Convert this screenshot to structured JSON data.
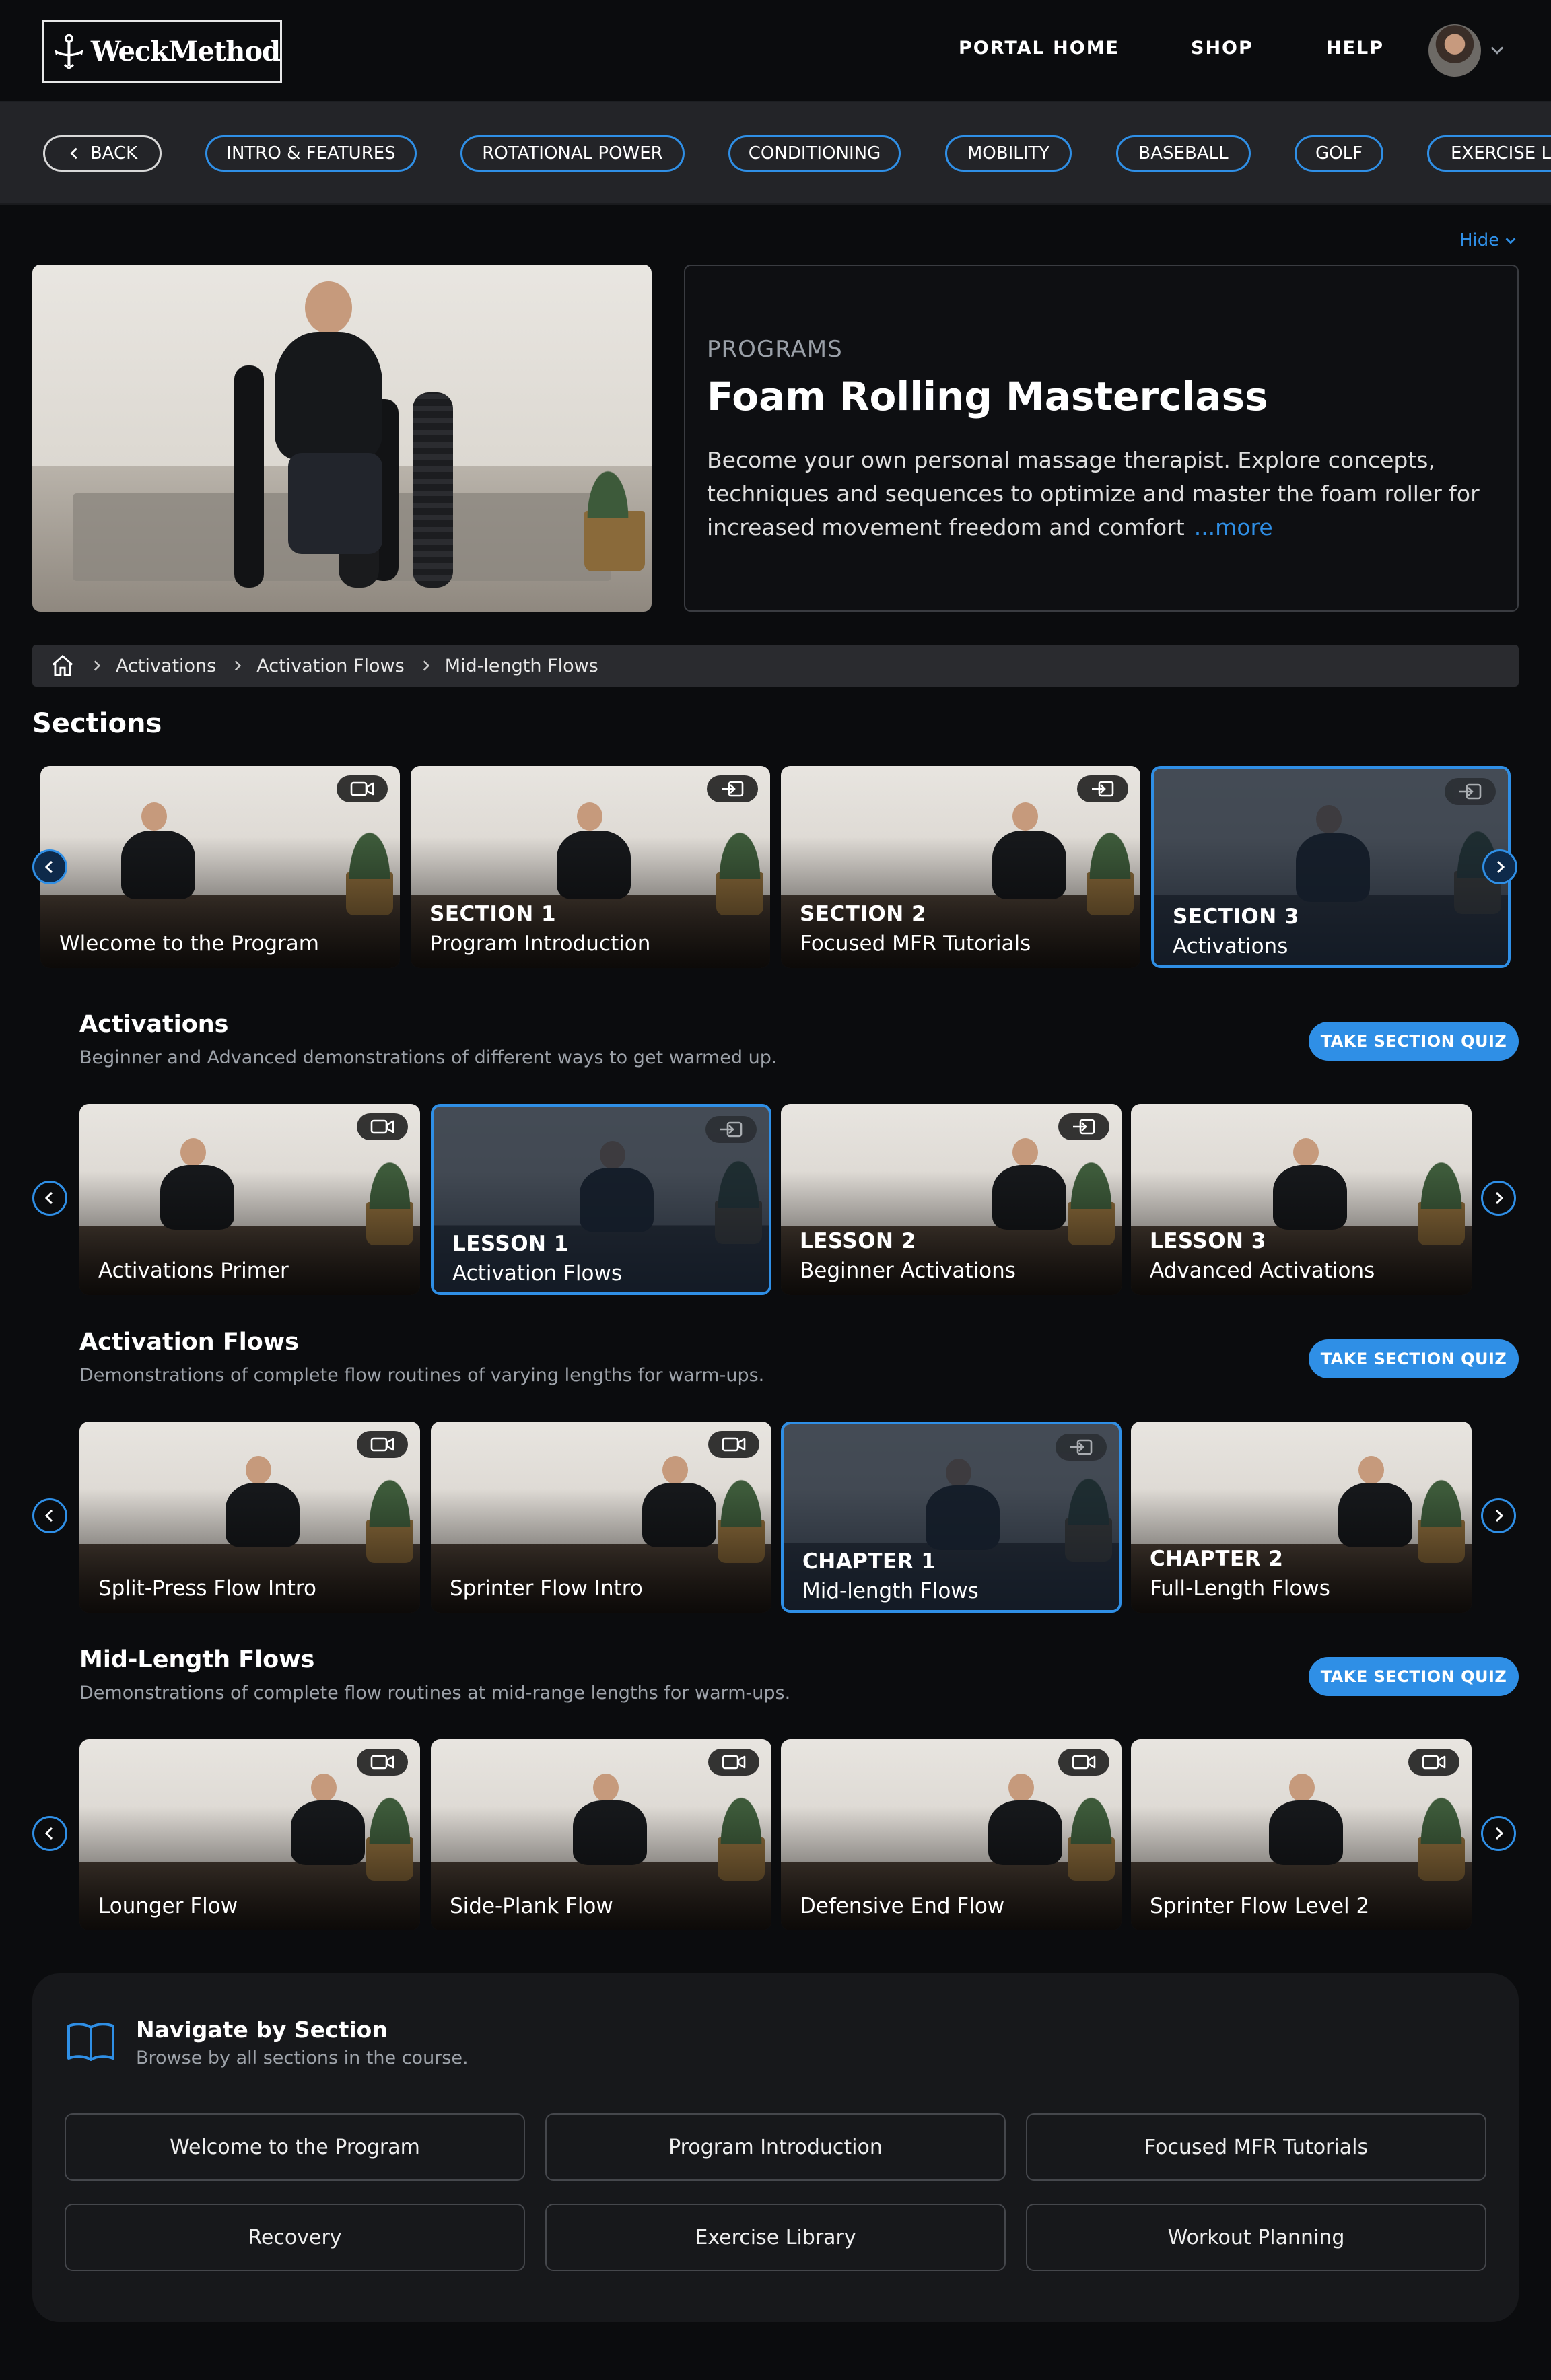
{
  "header": {
    "logo_text": "WeckMethod",
    "nav": [
      "PORTAL HOME",
      "SHOP",
      "HELP"
    ]
  },
  "filters": {
    "back": "BACK",
    "pills": [
      "INTRO & FEATURES",
      "ROTATIONAL POWER",
      "CONDITIONING",
      "MOBILITY",
      "BASEBALL",
      "GOLF",
      "EXERCISE LI"
    ]
  },
  "hero": {
    "hide": "Hide",
    "eyebrow": "PROGRAMS",
    "title": "Foam Rolling Masterclass",
    "description": "Become your own personal massage therapist. Explore concepts, techniques and sequences to optimize and master the foam roller for increased movement freedom and comfort",
    "more": "...more"
  },
  "breadcrumb": [
    "Activations",
    "Activation Flows",
    "Mid-length Flows"
  ],
  "sections_heading": "Sections",
  "sections": [
    {
      "top": "",
      "label": "Wlecome to the Program",
      "icon": "video-icon",
      "active": false
    },
    {
      "top": "SECTION 1",
      "label": "Program Introduction",
      "icon": "enter-icon",
      "active": false
    },
    {
      "top": "SECTION 2",
      "label": "Focused MFR Tutorials",
      "icon": "enter-icon",
      "active": false
    },
    {
      "top": "SECTION 3",
      "label": "Activations",
      "icon": "enter-icon",
      "active": true
    }
  ],
  "groups": [
    {
      "title": "Activations",
      "description": "Beginner and Advanced demonstrations of different ways to get warmed up.",
      "quiz": "TAKE SECTION QUIZ",
      "cards": [
        {
          "top": "",
          "label": "Activations Primer",
          "icon": "video-icon",
          "active": false
        },
        {
          "top": "LESSON 1",
          "label": "Activation Flows",
          "icon": "enter-icon",
          "active": true
        },
        {
          "top": "LESSON 2",
          "label": "Beginner Activations",
          "icon": "enter-icon",
          "active": false
        },
        {
          "top": "LESSON 3",
          "label": "Advanced Activations",
          "icon": "",
          "active": false
        }
      ]
    },
    {
      "title": "Activation Flows",
      "description": "Demonstrations of complete flow routines of varying lengths for warm-ups.",
      "quiz": "TAKE SECTION QUIZ",
      "cards": [
        {
          "top": "",
          "label": "Split-Press Flow Intro",
          "icon": "video-icon",
          "active": false
        },
        {
          "top": "",
          "label": "Sprinter Flow Intro",
          "icon": "video-icon",
          "active": false
        },
        {
          "top": "CHAPTER 1",
          "label": "Mid-length Flows",
          "icon": "enter-icon",
          "active": true
        },
        {
          "top": "CHAPTER 2",
          "label": "Full-Length Flows",
          "icon": "",
          "active": false
        }
      ]
    },
    {
      "title": "Mid-Length Flows",
      "description": "Demonstrations of complete flow routines at mid-range lengths for warm-ups.",
      "quiz": "TAKE SECTION QUIZ",
      "cards": [
        {
          "top": "",
          "label": "Lounger Flow",
          "icon": "video-icon",
          "active": false
        },
        {
          "top": "",
          "label": "Side-Plank Flow",
          "icon": "video-icon",
          "active": false
        },
        {
          "top": "",
          "label": "Defensive End Flow",
          "icon": "video-icon",
          "active": false
        },
        {
          "top": "",
          "label": "Sprinter Flow Level 2",
          "icon": "video-icon",
          "active": false
        }
      ]
    }
  ],
  "navigate": {
    "title": "Navigate by Section",
    "subtitle": "Browse by all sections in the course.",
    "buttons": [
      "Welcome to the Program",
      "Program Introduction",
      "Focused MFR Tutorials",
      "Recovery",
      "Exercise Library",
      "Workout Planning"
    ]
  },
  "colors": {
    "accent": "#2f8fe6",
    "background": "#0b0c0e",
    "panel": "#17181b"
  }
}
